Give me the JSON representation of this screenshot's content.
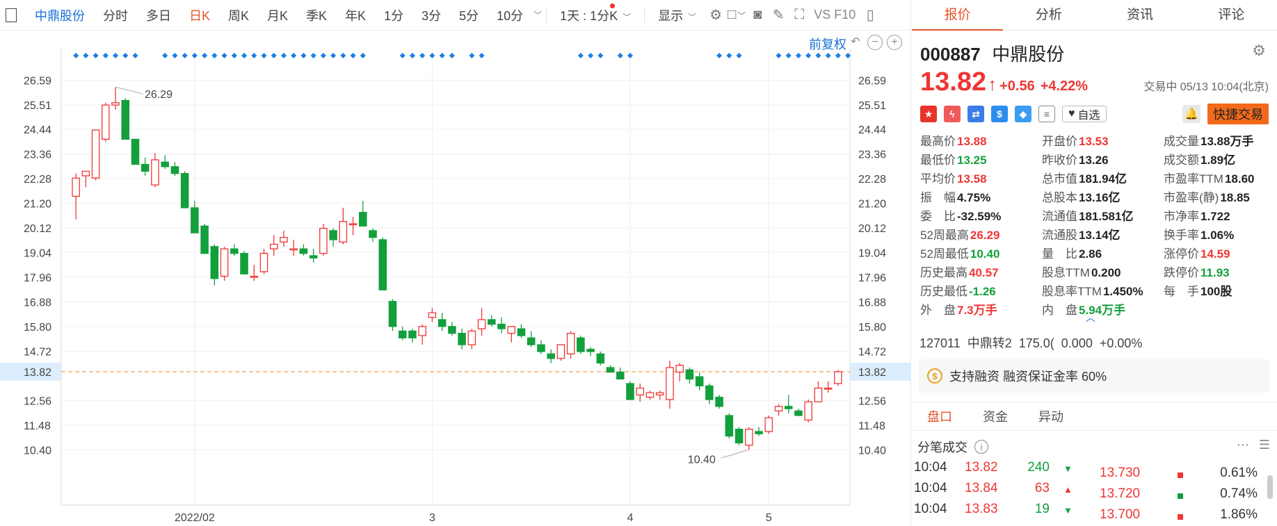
{
  "toolbar": {
    "stock": "中鼎股份",
    "periods": [
      "分时",
      "多日",
      "日K",
      "周K",
      "月K",
      "季K",
      "年K",
      "1分",
      "3分",
      "5分",
      "10分"
    ],
    "active_period": "日K",
    "interval": "1天 : 1分K",
    "display": "显示",
    "f10": "VS F10"
  },
  "chart": {
    "adjust": "前复权",
    "y_labels": [
      "26.59",
      "25.51",
      "24.44",
      "23.36",
      "22.28",
      "21.20",
      "20.12",
      "19.04",
      "17.96",
      "16.88",
      "15.80",
      "14.72",
      "13.82",
      "12.56",
      "11.48",
      "10.40"
    ],
    "x_labels": [
      "2022/02",
      "3",
      "4",
      "5"
    ],
    "current_price": "13.82",
    "max_label": "26.29",
    "min_label": "10.40"
  },
  "chart_data": {
    "type": "candlestick",
    "ylim": [
      9.8,
      27.3
    ],
    "current": 13.82,
    "ohlc": [
      [
        21.5,
        22.5,
        20.5,
        22.3
      ],
      [
        22.4,
        22.6,
        21.9,
        22.6
      ],
      [
        22.3,
        24.4,
        22.2,
        24.4
      ],
      [
        24.0,
        25.6,
        23.9,
        25.5
      ],
      [
        25.5,
        26.29,
        25.3,
        25.6
      ],
      [
        25.7,
        25.8,
        24.0,
        24.0
      ],
      [
        24.0,
        24.0,
        22.9,
        22.9
      ],
      [
        22.9,
        23.2,
        22.4,
        22.6
      ],
      [
        22.0,
        23.4,
        21.9,
        23.1
      ],
      [
        23.0,
        23.3,
        22.7,
        22.8
      ],
      [
        22.8,
        23.0,
        22.4,
        22.5
      ],
      [
        22.5,
        22.6,
        21.0,
        21.0
      ],
      [
        21.0,
        21.3,
        19.9,
        19.9
      ],
      [
        20.2,
        20.3,
        19.0,
        19.0
      ],
      [
        19.3,
        19.4,
        17.6,
        17.9
      ],
      [
        18.0,
        19.3,
        17.8,
        19.2
      ],
      [
        19.2,
        19.4,
        18.9,
        19.0
      ],
      [
        19.0,
        19.1,
        18.1,
        18.1
      ],
      [
        18.0,
        18.5,
        17.8,
        18.0
      ],
      [
        18.2,
        19.2,
        18.1,
        19.0
      ],
      [
        19.2,
        19.8,
        18.9,
        19.4
      ],
      [
        19.5,
        20.0,
        19.3,
        19.7
      ],
      [
        19.2,
        19.6,
        18.9,
        19.2
      ],
      [
        19.2,
        19.4,
        18.9,
        19.0
      ],
      [
        18.9,
        19.2,
        18.6,
        18.8
      ],
      [
        19.0,
        20.3,
        18.9,
        20.1
      ],
      [
        20.0,
        20.1,
        19.3,
        19.6
      ],
      [
        19.5,
        21.0,
        19.4,
        20.4
      ],
      [
        20.3,
        20.6,
        19.8,
        20.3
      ],
      [
        20.8,
        21.3,
        20.2,
        20.2
      ],
      [
        20.0,
        20.1,
        19.5,
        19.7
      ],
      [
        19.6,
        19.7,
        17.4,
        17.4
      ],
      [
        16.9,
        17.0,
        15.6,
        15.8
      ],
      [
        15.6,
        15.8,
        15.2,
        15.3
      ],
      [
        15.6,
        15.7,
        15.1,
        15.3
      ],
      [
        15.4,
        15.9,
        15.0,
        15.8
      ],
      [
        16.2,
        16.6,
        16.0,
        16.4
      ],
      [
        16.1,
        16.4,
        15.6,
        15.8
      ],
      [
        15.8,
        16.0,
        15.4,
        15.5
      ],
      [
        15.5,
        15.7,
        14.8,
        15.0
      ],
      [
        15.0,
        15.7,
        14.8,
        15.6
      ],
      [
        15.7,
        16.6,
        15.4,
        16.1
      ],
      [
        16.1,
        16.3,
        15.8,
        15.9
      ],
      [
        15.9,
        16.2,
        15.5,
        15.7
      ],
      [
        15.5,
        15.8,
        15.1,
        15.8
      ],
      [
        15.7,
        15.9,
        15.3,
        15.4
      ],
      [
        15.3,
        15.6,
        14.9,
        15.0
      ],
      [
        15.0,
        15.2,
        14.6,
        14.7
      ],
      [
        14.6,
        14.8,
        14.2,
        14.4
      ],
      [
        14.4,
        15.0,
        14.3,
        15.0
      ],
      [
        14.6,
        15.6,
        14.4,
        15.5
      ],
      [
        15.3,
        15.4,
        14.6,
        14.7
      ],
      [
        14.8,
        14.9,
        14.5,
        14.7
      ],
      [
        14.6,
        14.7,
        14.1,
        14.2
      ],
      [
        14.0,
        14.1,
        13.8,
        13.8
      ],
      [
        13.8,
        14.0,
        13.5,
        13.5
      ],
      [
        13.3,
        13.4,
        12.6,
        12.6
      ],
      [
        12.8,
        13.3,
        12.5,
        13.1
      ],
      [
        12.7,
        13.0,
        12.6,
        12.9
      ],
      [
        12.8,
        13.0,
        12.6,
        12.9
      ],
      [
        12.6,
        14.3,
        12.2,
        14.0
      ],
      [
        13.8,
        14.2,
        13.4,
        14.1
      ],
      [
        13.9,
        14.0,
        13.3,
        13.5
      ],
      [
        13.6,
        13.8,
        13.0,
        13.2
      ],
      [
        13.2,
        13.3,
        12.4,
        12.6
      ],
      [
        12.7,
        12.8,
        12.2,
        12.3
      ],
      [
        11.9,
        12.0,
        10.9,
        11.0
      ],
      [
        11.3,
        11.4,
        10.6,
        10.7
      ],
      [
        10.6,
        11.4,
        10.4,
        11.3
      ],
      [
        11.2,
        11.4,
        11.0,
        11.1
      ],
      [
        11.2,
        11.9,
        11.1,
        11.8
      ],
      [
        12.1,
        12.4,
        11.9,
        12.3
      ],
      [
        12.3,
        12.8,
        12.0,
        12.2
      ],
      [
        12.1,
        12.2,
        11.9,
        11.9
      ],
      [
        11.7,
        12.6,
        11.6,
        12.5
      ],
      [
        12.5,
        13.4,
        12.5,
        13.1
      ],
      [
        13.1,
        13.4,
        12.9,
        13.1
      ],
      [
        13.3,
        13.9,
        13.2,
        13.82
      ]
    ]
  },
  "tabs": [
    "报价",
    "分析",
    "资讯",
    "评论"
  ],
  "quote": {
    "code": "000887",
    "name": "中鼎股份",
    "price": "13.82",
    "change": "+0.56",
    "change_pct": "+4.22%",
    "status_time": "交易中 05/13 10:04(北京)",
    "watch": "自选",
    "fast_trade": "快捷交易",
    "fields": [
      {
        "label": "最高价",
        "value": "13.88",
        "color": "red"
      },
      {
        "label": "开盘价",
        "value": "13.53",
        "color": "red"
      },
      {
        "label": "成交量",
        "value": "13.88万手",
        "color": "dark"
      },
      {
        "label": "最低价",
        "value": "13.25",
        "color": "green"
      },
      {
        "label": "昨收价",
        "value": "13.26",
        "color": "dark"
      },
      {
        "label": "成交额",
        "value": "1.89亿",
        "color": "dark"
      },
      {
        "label": "平均价",
        "value": "13.58",
        "color": "red"
      },
      {
        "label": "总市值",
        "value": "181.94亿",
        "color": "dark"
      },
      {
        "label": "市盈率TTM",
        "value": "18.60",
        "color": "dark"
      },
      {
        "label": "振　幅",
        "value": "4.75%",
        "color": "dark"
      },
      {
        "label": "总股本",
        "value": "13.16亿",
        "color": "dark"
      },
      {
        "label": "市盈率(静)",
        "value": "18.85",
        "color": "dark"
      },
      {
        "label": "委　比",
        "value": "-32.59%",
        "color": "dark"
      },
      {
        "label": "流通值",
        "value": "181.581亿",
        "color": "dark"
      },
      {
        "label": "市净率",
        "value": "1.722",
        "color": "dark"
      },
      {
        "label": "52周最高",
        "value": "26.29",
        "color": "red"
      },
      {
        "label": "流通股",
        "value": "13.14亿",
        "color": "dark"
      },
      {
        "label": "换手率",
        "value": "1.06%",
        "color": "dark"
      },
      {
        "label": "52周最低",
        "value": "10.40",
        "color": "green"
      },
      {
        "label": "量　比",
        "value": "2.86",
        "color": "dark"
      },
      {
        "label": "涨停价",
        "value": "14.59",
        "color": "red"
      },
      {
        "label": "历史最高",
        "value": "40.57",
        "color": "red"
      },
      {
        "label": "股息TTM",
        "value": "0.200",
        "color": "dark"
      },
      {
        "label": "跌停价",
        "value": "11.93",
        "color": "green"
      },
      {
        "label": "历史最低",
        "value": "-1.26",
        "color": "green"
      },
      {
        "label": "股息率TTM",
        "value": "1.450%",
        "color": "dark"
      },
      {
        "label": "每　手",
        "value": "100股",
        "color": "dark"
      },
      {
        "label": "外　盘",
        "value": "7.3万手",
        "color": "red"
      },
      {
        "label": "内　盘",
        "value": "5.94万手",
        "color": "green"
      }
    ],
    "bond": {
      "code": "127011",
      "name": "中鼎转2",
      "price": "175.0(",
      "chg": "0.000",
      "pct": "+0.00%"
    },
    "margin": "支持融资 融资保证金率 60%"
  },
  "subtabs": [
    "盘口",
    "资金",
    "异动"
  ],
  "ticks": {
    "title": "分笔成交",
    "rows": [
      {
        "time": "10:04",
        "price": "13.82",
        "vol": "240",
        "dir": "down",
        "bid": "13.730",
        "pct": "0.61%",
        "c": "red"
      },
      {
        "time": "10:04",
        "price": "13.84",
        "vol": "63",
        "dir": "up",
        "bid": "13.720",
        "pct": "0.74%",
        "c": "green"
      },
      {
        "time": "10:04",
        "price": "13.83",
        "vol": "19",
        "dir": "down",
        "bid": "13.700",
        "pct": "1.86%",
        "c": "red"
      }
    ]
  },
  "colors": {
    "up": "#f03535",
    "down": "#13a03c",
    "accent": "#e8542a",
    "link": "#1a6fd6"
  }
}
